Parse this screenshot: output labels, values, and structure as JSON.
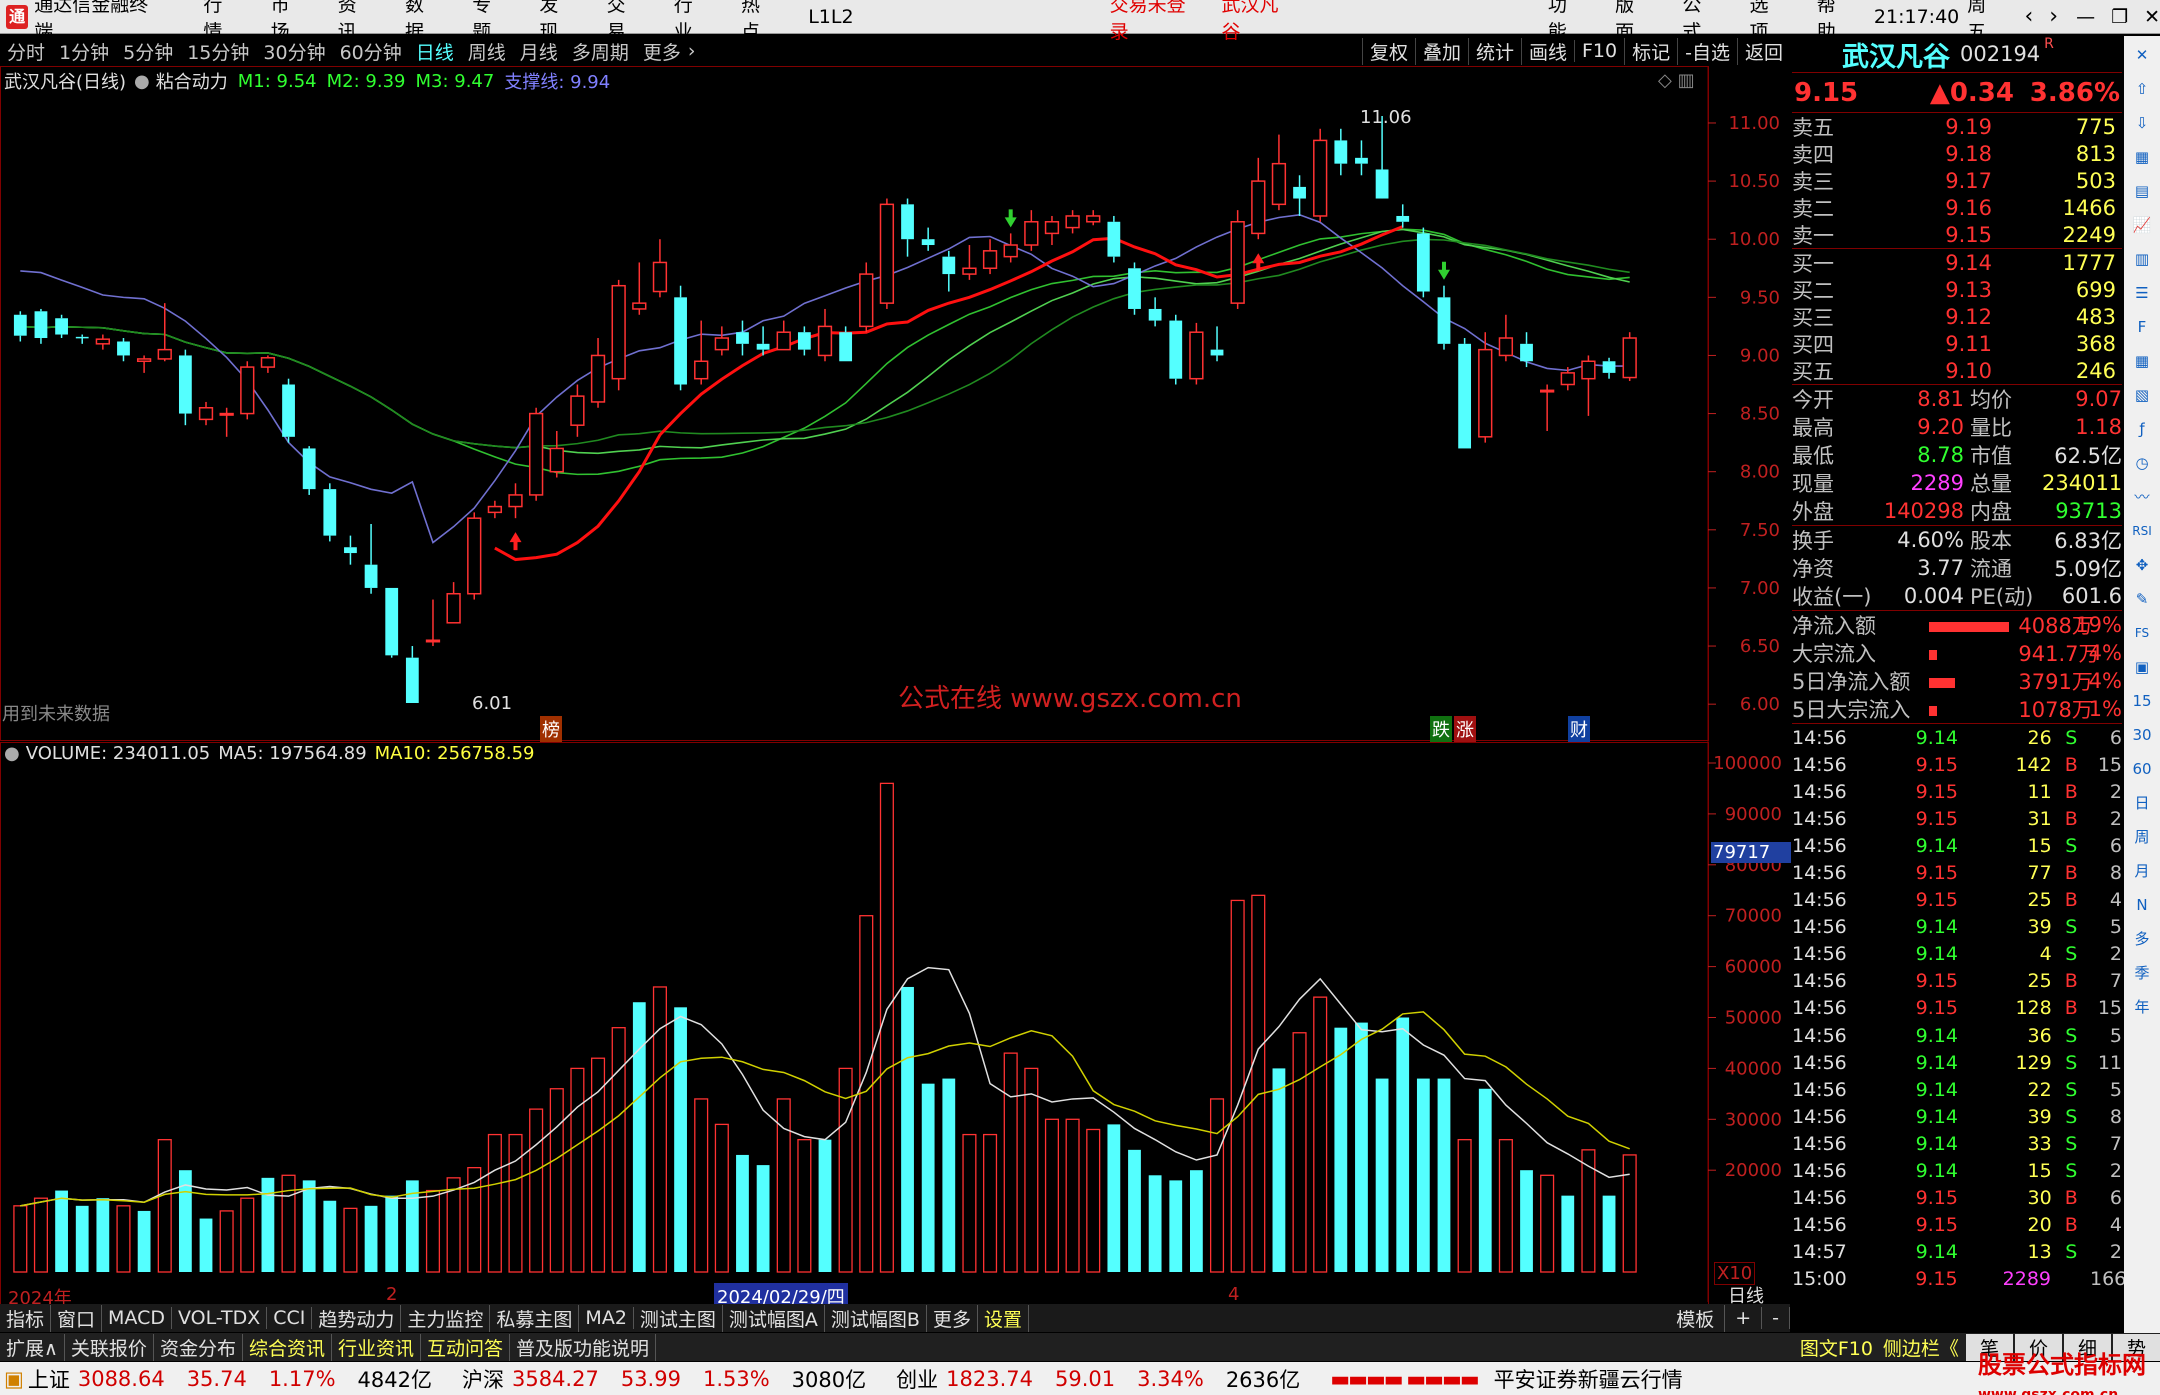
{
  "menubar": {
    "app_title": "通达信金融终端",
    "items": [
      "行情",
      "市场",
      "资讯",
      "数据",
      "专题",
      "发现",
      "交易",
      "行业",
      "热点",
      "L1L2"
    ],
    "status_trade": "交易未登录",
    "status_stock": "武汉凡谷",
    "right_items": [
      "功能",
      "版面",
      "公式",
      "选项",
      "帮助"
    ],
    "clock": "21:17:40",
    "weekday": "周五"
  },
  "periodbar": {
    "items": [
      "分时",
      "1分钟",
      "5分钟",
      "15分钟",
      "30分钟",
      "60分钟",
      "日线",
      "周线",
      "月线",
      "多周期",
      "更多"
    ],
    "active": "日线",
    "right": [
      "复权",
      "叠加",
      "统计",
      "画线",
      "F10",
      "标记",
      "-自选",
      "返回"
    ]
  },
  "chart_header": {
    "name": "武汉凡谷(日线)",
    "indicator": "粘合动力",
    "m1": "M1: 9.54",
    "m2": "M2: 9.39",
    "m3": "M3: 9.47",
    "support": "支撑线: 9.94",
    "future_note": "用到未来数据",
    "watermark": "公式在线  www.gszx.com.cn",
    "high_label": "11.06",
    "low_label": "6.01",
    "tag_bang": "榜",
    "tag_die": "跌",
    "tag_zhang": "涨",
    "tag_cai": "财"
  },
  "price_axis": [
    "11.00",
    "10.50",
    "10.00",
    "9.50",
    "9.00",
    "8.50",
    "8.00",
    "7.50",
    "7.00",
    "6.50",
    "6.00"
  ],
  "volume_header": {
    "volume": "VOLUME: 234011.05",
    "ma5": "MA5: 197564.89",
    "ma10": "MA10: 256758.59",
    "cursor_value": "79717",
    "x10": "X10"
  },
  "volume_axis": [
    "100000",
    "90000",
    "80000",
    "70000",
    "60000",
    "50000",
    "40000",
    "30000",
    "20000"
  ],
  "date_axis": {
    "start": "2024年",
    "m2": "2",
    "cursor": "2024/02/29/四",
    "m4": "4",
    "period": "日线"
  },
  "chart_data": {
    "type": "bar",
    "title": "",
    "candles": [
      [
        9.35,
        9.17,
        9.38,
        9.12
      ],
      [
        9.38,
        9.15,
        9.4,
        9.1
      ],
      [
        9.32,
        9.18,
        9.35,
        9.15
      ],
      [
        9.16,
        9.15,
        9.18,
        9.1
      ],
      [
        9.1,
        9.14,
        9.18,
        9.05
      ],
      [
        9.12,
        9.0,
        9.15,
        8.95
      ],
      [
        8.95,
        8.97,
        9.0,
        8.85
      ],
      [
        8.97,
        9.05,
        9.45,
        8.95
      ],
      [
        9.0,
        8.5,
        9.05,
        8.4
      ],
      [
        8.45,
        8.55,
        8.6,
        8.4
      ],
      [
        8.5,
        8.5,
        8.55,
        8.3
      ],
      [
        8.5,
        8.9,
        8.95,
        8.45
      ],
      [
        8.9,
        8.98,
        9.0,
        8.85
      ],
      [
        8.75,
        8.3,
        8.8,
        8.25
      ],
      [
        8.2,
        7.85,
        8.22,
        7.8
      ],
      [
        7.85,
        7.45,
        7.9,
        7.4
      ],
      [
        7.35,
        7.3,
        7.45,
        7.2
      ],
      [
        7.2,
        7.0,
        7.55,
        6.95
      ],
      [
        7.0,
        6.42,
        7.0,
        6.4
      ],
      [
        6.4,
        6.01,
        6.5,
        6.01
      ],
      [
        6.55,
        6.55,
        6.9,
        6.5
      ],
      [
        6.7,
        6.95,
        7.05,
        6.7
      ],
      [
        6.95,
        7.6,
        7.65,
        6.9
      ],
      [
        7.65,
        7.7,
        7.75,
        7.6
      ],
      [
        7.7,
        7.8,
        7.9,
        7.6
      ],
      [
        7.8,
        8.5,
        8.55,
        7.75
      ],
      [
        8.0,
        8.2,
        8.35,
        7.95
      ],
      [
        8.4,
        8.65,
        8.75,
        8.3
      ],
      [
        8.6,
        9.0,
        9.15,
        8.55
      ],
      [
        8.8,
        9.6,
        9.65,
        8.7
      ],
      [
        9.4,
        9.45,
        9.8,
        9.35
      ],
      [
        9.55,
        9.8,
        10.0,
        9.5
      ],
      [
        9.5,
        8.75,
        9.6,
        8.7
      ],
      [
        8.8,
        8.95,
        9.3,
        8.75
      ],
      [
        9.05,
        9.15,
        9.25,
        9.0
      ],
      [
        9.2,
        9.1,
        9.3,
        9.0
      ],
      [
        9.1,
        9.05,
        9.25,
        9.0
      ],
      [
        9.05,
        9.2,
        9.3,
        9.05
      ],
      [
        9.2,
        9.05,
        9.25,
        9.0
      ],
      [
        9.0,
        9.25,
        9.4,
        8.95
      ],
      [
        9.2,
        8.95,
        9.25,
        8.95
      ],
      [
        9.25,
        9.7,
        9.8,
        9.2
      ],
      [
        9.45,
        10.3,
        10.35,
        9.4
      ],
      [
        10.3,
        10.0,
        10.35,
        9.85
      ],
      [
        10.0,
        9.95,
        10.1,
        9.9
      ],
      [
        9.85,
        9.7,
        9.9,
        9.55
      ],
      [
        9.7,
        9.75,
        9.95,
        9.65
      ],
      [
        9.75,
        9.9,
        10.0,
        9.7
      ],
      [
        9.85,
        9.95,
        10.05,
        9.8
      ],
      [
        9.95,
        10.15,
        10.25,
        9.9
      ],
      [
        10.05,
        10.15,
        10.2,
        9.95
      ],
      [
        10.1,
        10.2,
        10.25,
        10.05
      ],
      [
        10.15,
        10.2,
        10.25,
        10.12
      ],
      [
        10.15,
        9.85,
        10.2,
        9.8
      ],
      [
        9.75,
        9.4,
        9.8,
        9.35
      ],
      [
        9.4,
        9.3,
        9.5,
        9.25
      ],
      [
        9.3,
        8.8,
        9.35,
        8.75
      ],
      [
        8.8,
        9.2,
        9.28,
        8.75
      ],
      [
        9.05,
        9.0,
        9.25,
        8.95
      ],
      [
        9.45,
        10.15,
        10.25,
        9.4
      ],
      [
        10.05,
        10.5,
        10.7,
        10.0
      ],
      [
        10.3,
        10.65,
        10.9,
        10.25
      ],
      [
        10.45,
        10.35,
        10.55,
        10.2
      ],
      [
        10.2,
        10.85,
        10.95,
        10.15
      ],
      [
        10.85,
        10.65,
        10.95,
        10.55
      ],
      [
        10.7,
        10.65,
        10.85,
        10.55
      ],
      [
        10.6,
        10.35,
        11.06,
        10.55
      ],
      [
        10.2,
        10.15,
        10.3,
        10.1
      ],
      [
        10.05,
        9.55,
        10.1,
        9.5
      ],
      [
        9.5,
        9.1,
        9.6,
        9.05
      ],
      [
        9.1,
        8.2,
        9.15,
        8.2
      ],
      [
        8.3,
        9.05,
        9.2,
        8.25
      ],
      [
        9.0,
        9.15,
        9.35,
        8.95
      ],
      [
        9.1,
        8.95,
        9.2,
        8.9
      ],
      [
        8.7,
        8.7,
        8.75,
        8.35
      ],
      [
        8.75,
        8.85,
        8.9,
        8.7
      ],
      [
        8.8,
        8.95,
        9.0,
        8.48
      ],
      [
        8.95,
        8.85,
        8.98,
        8.8
      ],
      [
        8.81,
        9.15,
        9.2,
        8.78
      ]
    ],
    "volumes": [
      [
        13000,
        0
      ],
      [
        14500,
        0
      ],
      [
        16000,
        1
      ],
      [
        13000,
        1
      ],
      [
        14500,
        1
      ],
      [
        13000,
        0
      ],
      [
        12000,
        1
      ],
      [
        26000,
        0
      ],
      [
        20000,
        1
      ],
      [
        10500,
        1
      ],
      [
        12000,
        0
      ],
      [
        14500,
        0
      ],
      [
        18500,
        1
      ],
      [
        19000,
        0
      ],
      [
        18000,
        1
      ],
      [
        14000,
        1
      ],
      [
        12500,
        0
      ],
      [
        13000,
        1
      ],
      [
        15000,
        1
      ],
      [
        18000,
        1
      ],
      [
        16000,
        0
      ],
      [
        18500,
        0
      ],
      [
        20500,
        0
      ],
      [
        27000,
        0
      ],
      [
        27000,
        0
      ],
      [
        32000,
        0
      ],
      [
        36000,
        0
      ],
      [
        40000,
        0
      ],
      [
        42000,
        0
      ],
      [
        48000,
        0
      ],
      [
        53000,
        1
      ],
      [
        56000,
        0
      ],
      [
        52000,
        1
      ],
      [
        34000,
        0
      ],
      [
        29000,
        0
      ],
      [
        23000,
        1
      ],
      [
        21000,
        1
      ],
      [
        34000,
        0
      ],
      [
        26000,
        0
      ],
      [
        26000,
        1
      ],
      [
        40000,
        0
      ],
      [
        70000,
        0
      ],
      [
        96000,
        0
      ],
      [
        56000,
        1
      ],
      [
        37000,
        1
      ],
      [
        38000,
        1
      ],
      [
        27000,
        0
      ],
      [
        27000,
        0
      ],
      [
        43000,
        0
      ],
      [
        40000,
        0
      ],
      [
        30000,
        0
      ],
      [
        30000,
        0
      ],
      [
        28000,
        0
      ],
      [
        29000,
        1
      ],
      [
        24000,
        1
      ],
      [
        19000,
        1
      ],
      [
        18000,
        1
      ],
      [
        20000,
        1
      ],
      [
        34000,
        0
      ],
      [
        73000,
        0
      ],
      [
        74000,
        0
      ],
      [
        40000,
        1
      ],
      [
        47000,
        0
      ],
      [
        54000,
        0
      ],
      [
        48000,
        1
      ],
      [
        49000,
        1
      ],
      [
        38000,
        1
      ],
      [
        50000,
        1
      ],
      [
        38000,
        1
      ],
      [
        38000,
        1
      ],
      [
        26000,
        0
      ],
      [
        36000,
        1
      ],
      [
        26000,
        0
      ],
      [
        20000,
        1
      ],
      [
        19000,
        0
      ],
      [
        15000,
        1
      ],
      [
        24000,
        0
      ],
      [
        15000,
        1
      ],
      [
        23000,
        0
      ]
    ],
    "ma_support": [
      9.94
    ],
    "ylim": [
      6.0,
      11.06
    ],
    "vol_ylim": [
      0,
      100000
    ]
  },
  "quote": {
    "stock_name": "武汉凡谷",
    "code": "002194",
    "badge": "R",
    "price": "9.15",
    "change": "▲0.34",
    "change_pct": "3.86%",
    "asks": [
      [
        "卖五",
        "9.19",
        "775"
      ],
      [
        "卖四",
        "9.18",
        "813"
      ],
      [
        "卖三",
        "9.17",
        "503"
      ],
      [
        "卖二",
        "9.16",
        "1466"
      ],
      [
        "卖一",
        "9.15",
        "2249"
      ]
    ],
    "bids": [
      [
        "买一",
        "9.14",
        "1777"
      ],
      [
        "买二",
        "9.13",
        "699"
      ],
      [
        "买三",
        "9.12",
        "483"
      ],
      [
        "买四",
        "9.11",
        "368"
      ],
      [
        "买五",
        "9.10",
        "246"
      ]
    ],
    "stats1": [
      [
        "今开",
        "8.81",
        "均价",
        "9.07"
      ],
      [
        "最高",
        "9.20",
        "量比",
        "1.18"
      ],
      [
        "最低",
        "8.78",
        "市值",
        "62.5亿"
      ],
      [
        "现量",
        "2289",
        "总量",
        "234011"
      ],
      [
        "外盘",
        "140298",
        "内盘",
        "93713"
      ]
    ],
    "stats2": [
      [
        "换手",
        "4.60%",
        "股本",
        "6.83亿"
      ],
      [
        "净资",
        "3.77",
        "流通",
        "5.09亿"
      ],
      [
        "收益(一)",
        "0.004",
        "PE(动)",
        "601.6"
      ]
    ],
    "flows": [
      [
        "净流入额",
        "4088万",
        "19%"
      ],
      [
        "大宗流入",
        "941.7万",
        "4%"
      ],
      [
        "5日净流入额",
        "3791万",
        "4%"
      ],
      [
        "5日大宗流入",
        "1078万",
        "1%"
      ]
    ],
    "ticks": [
      [
        "14:56",
        "9.14",
        "26",
        "S",
        "6"
      ],
      [
        "14:56",
        "9.15",
        "142",
        "B",
        "15"
      ],
      [
        "14:56",
        "9.15",
        "11",
        "B",
        "2"
      ],
      [
        "14:56",
        "9.15",
        "31",
        "B",
        "2"
      ],
      [
        "14:56",
        "9.14",
        "15",
        "S",
        "6"
      ],
      [
        "14:56",
        "9.15",
        "77",
        "B",
        "8"
      ],
      [
        "14:56",
        "9.15",
        "25",
        "B",
        "4"
      ],
      [
        "14:56",
        "9.14",
        "39",
        "S",
        "5"
      ],
      [
        "14:56",
        "9.14",
        "4",
        "S",
        "2"
      ],
      [
        "14:56",
        "9.15",
        "25",
        "B",
        "7"
      ],
      [
        "14:56",
        "9.15",
        "128",
        "B",
        "15"
      ],
      [
        "14:56",
        "9.14",
        "36",
        "S",
        "5"
      ],
      [
        "14:56",
        "9.14",
        "129",
        "S",
        "11"
      ],
      [
        "14:56",
        "9.14",
        "22",
        "S",
        "5"
      ],
      [
        "14:56",
        "9.14",
        "39",
        "S",
        "8"
      ],
      [
        "14:56",
        "9.14",
        "33",
        "S",
        "7"
      ],
      [
        "14:56",
        "9.14",
        "15",
        "S",
        "2"
      ],
      [
        "14:56",
        "9.15",
        "30",
        "B",
        "6"
      ],
      [
        "14:56",
        "9.15",
        "20",
        "B",
        "4"
      ],
      [
        "14:57",
        "9.14",
        "13",
        "S",
        "2"
      ],
      [
        "15:00",
        "9.15",
        "2289",
        "",
        "166"
      ]
    ]
  },
  "sidebar": [
    "日",
    "周",
    "月",
    "N",
    "多",
    "季",
    "年",
    "15",
    "30",
    "60",
    "RSI",
    "FS"
  ],
  "tabbar": {
    "items": [
      "指标",
      "窗口",
      "MACD",
      "VOL-TDX",
      "CCI",
      "趋势动力",
      "主力监控",
      "私募主图",
      "MA2",
      "测试主图",
      "测试幅图A",
      "测试幅图B",
      "更多",
      "设置"
    ],
    "right": [
      "模板",
      "+",
      "-"
    ]
  },
  "extbar": {
    "items": [
      "扩展∧",
      "关联报价",
      "资金分布",
      "综合资讯",
      "行业资讯",
      "互动问答",
      "普及版功能说明"
    ],
    "right": [
      "图文F10",
      "侧边栏《",
      "笔",
      "价",
      "细",
      "势"
    ]
  },
  "statusbar": {
    "sh": [
      "上证",
      "3088.64",
      "35.74",
      "1.17%",
      "4842亿"
    ],
    "sz": [
      "沪深",
      "3584.27",
      "53.99",
      "1.53%",
      "3080亿"
    ],
    "cy": [
      "创业",
      "1823.74",
      "59.01",
      "3.34%",
      "2636亿"
    ],
    "broker": "平安证券新疆云行情",
    "logo_text": "股票公式指标网",
    "logo_url": "www.gszx.com.cn"
  },
  "colors": {
    "up": "#ff3232",
    "down": "#54ffff",
    "ma_red": "#ff1010",
    "ma_green": "#30c030",
    "blue_line": "#7070d0",
    "yellow": "#ffff55"
  }
}
